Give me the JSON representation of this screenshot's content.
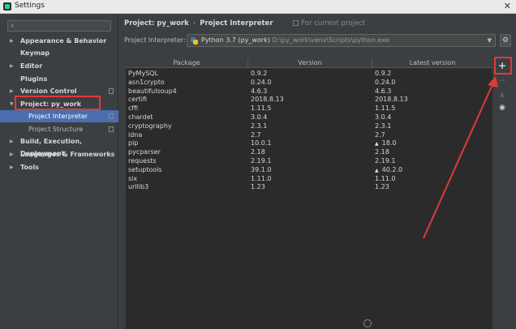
{
  "window": {
    "title": "Settings",
    "close": "✕"
  },
  "sidebar": {
    "search_placeholder": "",
    "items": [
      {
        "label": "Appearance & Behavior",
        "arrow": "▶"
      },
      {
        "label": "Keymap"
      },
      {
        "label": "Editor",
        "arrow": "▶"
      },
      {
        "label": "Plugins"
      },
      {
        "label": "Version Control",
        "arrow": "▶"
      },
      {
        "label": "Project: py_work",
        "arrow": "▼"
      },
      {
        "label": "Project Interpreter"
      },
      {
        "label": "Project Structure"
      },
      {
        "label": "Build, Execution, Deployment",
        "arrow": "▶"
      },
      {
        "label": "Languages & Frameworks",
        "arrow": "▶"
      },
      {
        "label": "Tools",
        "arrow": "▶"
      }
    ]
  },
  "breadcrumb": {
    "project": "Project: py_work",
    "separator": "›",
    "page": "Project Interpreter",
    "note": "For current project"
  },
  "interpreter": {
    "label": "Project Interpreter:",
    "name": "Python 3.7 (py_work)",
    "path": "D:\\py_work\\venv\\Scripts\\python.exe"
  },
  "table": {
    "columns": [
      "Package",
      "Version",
      "Latest version"
    ],
    "rows": [
      {
        "package": "PyMySQL",
        "version": "0.9.2",
        "latest": "0.9.2",
        "upgrade": false
      },
      {
        "package": "asn1crypto",
        "version": "0.24.0",
        "latest": "0.24.0",
        "upgrade": false
      },
      {
        "package": "beautifulsoup4",
        "version": "4.6.3",
        "latest": "4.6.3",
        "upgrade": false
      },
      {
        "package": "certifi",
        "version": "2018.8.13",
        "latest": "2018.8.13",
        "upgrade": false
      },
      {
        "package": "cffi",
        "version": "1.11.5",
        "latest": "1.11.5",
        "upgrade": false
      },
      {
        "package": "chardet",
        "version": "3.0.4",
        "latest": "3.0.4",
        "upgrade": false
      },
      {
        "package": "cryptography",
        "version": "2.3.1",
        "latest": "2.3.1",
        "upgrade": false
      },
      {
        "package": "idna",
        "version": "2.7",
        "latest": "2.7",
        "upgrade": false
      },
      {
        "package": "pip",
        "version": "10.0.1",
        "latest": "18.0",
        "upgrade": true
      },
      {
        "package": "pycparser",
        "version": "2.18",
        "latest": "2.18",
        "upgrade": false
      },
      {
        "package": "requests",
        "version": "2.19.1",
        "latest": "2.19.1",
        "upgrade": false
      },
      {
        "package": "setuptools",
        "version": "39.1.0",
        "latest": "40.2.0",
        "upgrade": true
      },
      {
        "package": "six",
        "version": "1.11.0",
        "latest": "1.11.0",
        "upgrade": false
      },
      {
        "package": "urllib3",
        "version": "1.23",
        "latest": "1.23",
        "upgrade": false
      }
    ]
  },
  "toolbar": {
    "add": "+",
    "remove": "−",
    "upgrade": "▲",
    "show_early": "◉"
  },
  "icons": {
    "search": "search-icon",
    "gear": "gear-icon",
    "dropdown": "chevron-down-icon",
    "upgrade_marker": "▲"
  },
  "colors": {
    "selection": "#4b6eaf",
    "annotation": "#e03a3a",
    "background": "#3c3f41",
    "table_bg": "#2b2b2b"
  }
}
